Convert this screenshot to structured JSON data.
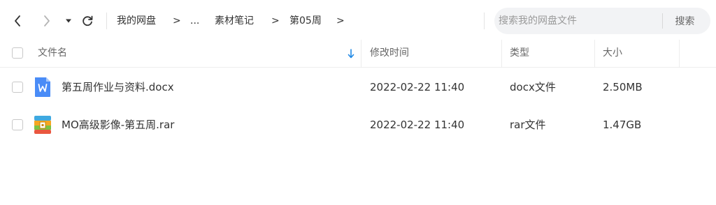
{
  "toolbar": {
    "back_icon": "chevron-left-icon",
    "forward_icon": "chevron-right-icon",
    "history_icon": "caret-down-icon",
    "refresh_icon": "refresh-icon"
  },
  "breadcrumb": {
    "items": [
      "我的网盘",
      "...",
      "素材笔记",
      "第05周"
    ],
    "separator": ">"
  },
  "search": {
    "placeholder": "搜索我的网盘文件",
    "button_label": "搜索"
  },
  "table": {
    "columns": [
      "文件名",
      "修改时间",
      "类型",
      "大小"
    ],
    "sort_icon": "arrow-down-icon",
    "rows": [
      {
        "name": "第五周作业与资料.docx",
        "modified": "2022-02-22 11:40",
        "type": "docx文件",
        "size": "2.50MB",
        "icon": "word-doc-icon"
      },
      {
        "name": "MO高级影像-第五周.rar",
        "modified": "2022-02-22 11:40",
        "type": "rar文件",
        "size": "1.47GB",
        "icon": "rar-archive-icon"
      }
    ]
  },
  "colors": {
    "accent": "#1e88e5",
    "word_blue": "#4a8cf7",
    "search_bg": "#f2f3f5"
  }
}
